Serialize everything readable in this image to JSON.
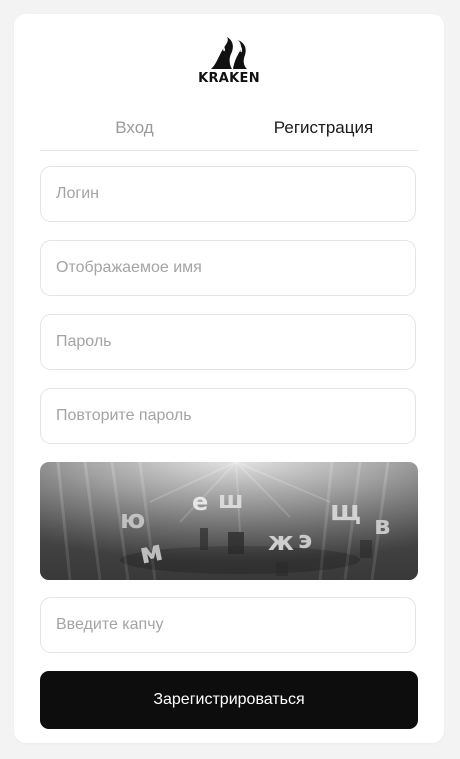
{
  "brand": {
    "name": "KRAKEN"
  },
  "tabs": [
    {
      "label": "Вход",
      "active": false
    },
    {
      "label": "Регистрация",
      "active": true
    }
  ],
  "form": {
    "login": {
      "placeholder": "Логин",
      "value": ""
    },
    "display_name": {
      "placeholder": "Отображаемое имя",
      "value": ""
    },
    "password": {
      "placeholder": "Пароль",
      "value": ""
    },
    "password_repeat": {
      "placeholder": "Повторите пароль",
      "value": ""
    },
    "captcha_input": {
      "placeholder": "Введите капчу",
      "value": ""
    }
  },
  "captcha": {
    "letters": [
      "ю",
      "м",
      "е",
      "ш",
      "ж",
      "э",
      "щ",
      "в"
    ]
  },
  "submit": {
    "label": "Зарегистрироваться"
  },
  "colors": {
    "background": "#f3f3f3",
    "card": "#ffffff",
    "button": "#0d0d0d",
    "inactive_tab": "#9a9a9a",
    "placeholder": "#a4a4a4"
  }
}
